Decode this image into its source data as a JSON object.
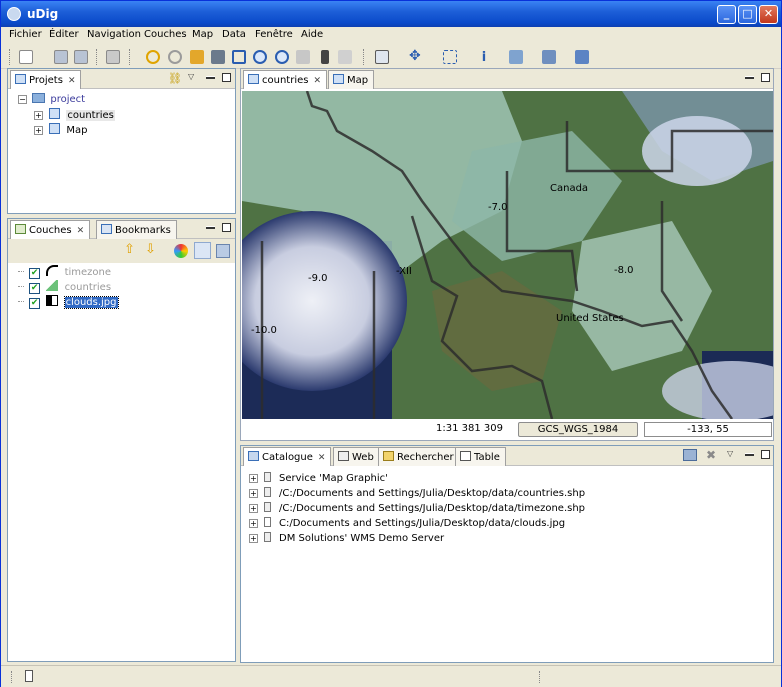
{
  "window": {
    "title": "uDig",
    "min_label": "_",
    "max_label": "□",
    "close_label": "✕"
  },
  "menu": [
    "Fichier",
    "Éditer",
    "Navigation",
    "Couches",
    "Map",
    "Data",
    "Fenêtre",
    "Aide"
  ],
  "projects_panel": {
    "tab": "Projets",
    "root": "project",
    "children": [
      "countries",
      "Map"
    ]
  },
  "layers_panel": {
    "tabs": [
      "Couches",
      "Bookmarks"
    ],
    "layers": [
      {
        "name": "timezone",
        "checked": true
      },
      {
        "name": "countries",
        "checked": true
      },
      {
        "name": "clouds.jpg",
        "checked": true,
        "selected": true
      }
    ]
  },
  "editor_tabs": [
    "countries",
    "Map"
  ],
  "map": {
    "labels": [
      {
        "text": "Canada"
      },
      {
        "text": "United States"
      },
      {
        "text": "-7.0"
      },
      {
        "text": "-8.0"
      },
      {
        "text": "-9.0"
      },
      {
        "text": "-10.0"
      },
      {
        "text": "-XII"
      }
    ]
  },
  "status": {
    "scale": "1:31 381 309",
    "crs": "GCS_WGS_1984",
    "coords": "-133, 55"
  },
  "catalog": {
    "tabs": [
      "Catalogue",
      "Web",
      "Rechercher",
      "Table"
    ],
    "items": [
      "Service 'Map Graphic'",
      "/C:/Documents and Settings/Julia/Desktop/data/countries.shp",
      "/C:/Documents and Settings/Julia/Desktop/data/timezone.shp",
      "C:/Documents and Settings/Julia/Desktop/data/clouds.jpg",
      "DM Solutions' WMS Demo Server"
    ]
  },
  "colors": {
    "title_bar": "#0a49c9",
    "chrome": "#ece9d8",
    "selection": "#316ac5",
    "panel_border": "#7f9db9"
  }
}
